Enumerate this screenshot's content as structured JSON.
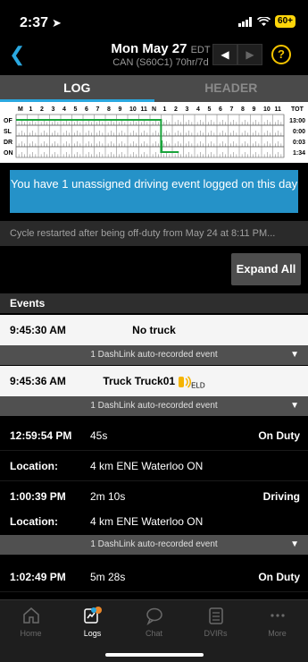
{
  "status_bar": {
    "time": "2:37",
    "battery": "60+"
  },
  "nav": {
    "date": "Mon May 27",
    "timezone": "EDT",
    "cycle": "CAN (S60C1) 70hr/7d",
    "help": "?"
  },
  "tabs": [
    {
      "label": "LOG",
      "active": true
    },
    {
      "label": "HEADER",
      "active": false
    }
  ],
  "graph": {
    "hour_labels": [
      "M",
      "1",
      "2",
      "3",
      "4",
      "5",
      "6",
      "7",
      "8",
      "9",
      "10",
      "11",
      "N",
      "1",
      "2",
      "3",
      "4",
      "5",
      "6",
      "7",
      "8",
      "9",
      "10",
      "11"
    ],
    "tot_label": "TOT",
    "rows": [
      {
        "label": "OF",
        "total": "13:00"
      },
      {
        "label": "SL",
        "total": "0:00"
      },
      {
        "label": "DR",
        "total": "0:03"
      },
      {
        "label": "ON",
        "total": "1:34"
      }
    ],
    "line_color": "#1aa33b"
  },
  "banner": {
    "text": "You have 1 unassigned driving event logged on this day"
  },
  "cycle_text": "Cycle restarted after being off-duty from May 24 at 8:11 PM...",
  "expand_all": "Expand All",
  "events_header": "Events",
  "events": [
    {
      "time": "9:45:30 AM",
      "center": "No truck"
    },
    {
      "dashlink": "1 DashLink auto-recorded event"
    },
    {
      "time": "9:45:36 AM",
      "center": "Truck Truck01",
      "eld": "ELD"
    },
    {
      "dashlink": "1 DashLink auto-recorded event"
    },
    {
      "time": "12:59:54 PM",
      "duration": "45s",
      "status": "On Duty"
    },
    {
      "location_label": "Location:",
      "location": "4 km ENE Waterloo ON"
    },
    {
      "time": "1:00:39 PM",
      "duration": "2m 10s",
      "status": "Driving"
    },
    {
      "location_label": "Location:",
      "location": "4 km ENE Waterloo ON"
    },
    {
      "dashlink": "1 DashLink auto-recorded event"
    },
    {
      "time": "1:02:49 PM",
      "duration": "5m 28s",
      "status": "On Duty"
    }
  ],
  "tabbar": [
    {
      "label": "Home",
      "icon": "home-icon",
      "active": false
    },
    {
      "label": "Logs",
      "icon": "logs-icon",
      "active": true
    },
    {
      "label": "Chat",
      "icon": "chat-icon",
      "active": false
    },
    {
      "label": "DVIRs",
      "icon": "dvirs-icon",
      "active": false
    },
    {
      "label": "More",
      "icon": "more-icon",
      "active": false
    }
  ]
}
